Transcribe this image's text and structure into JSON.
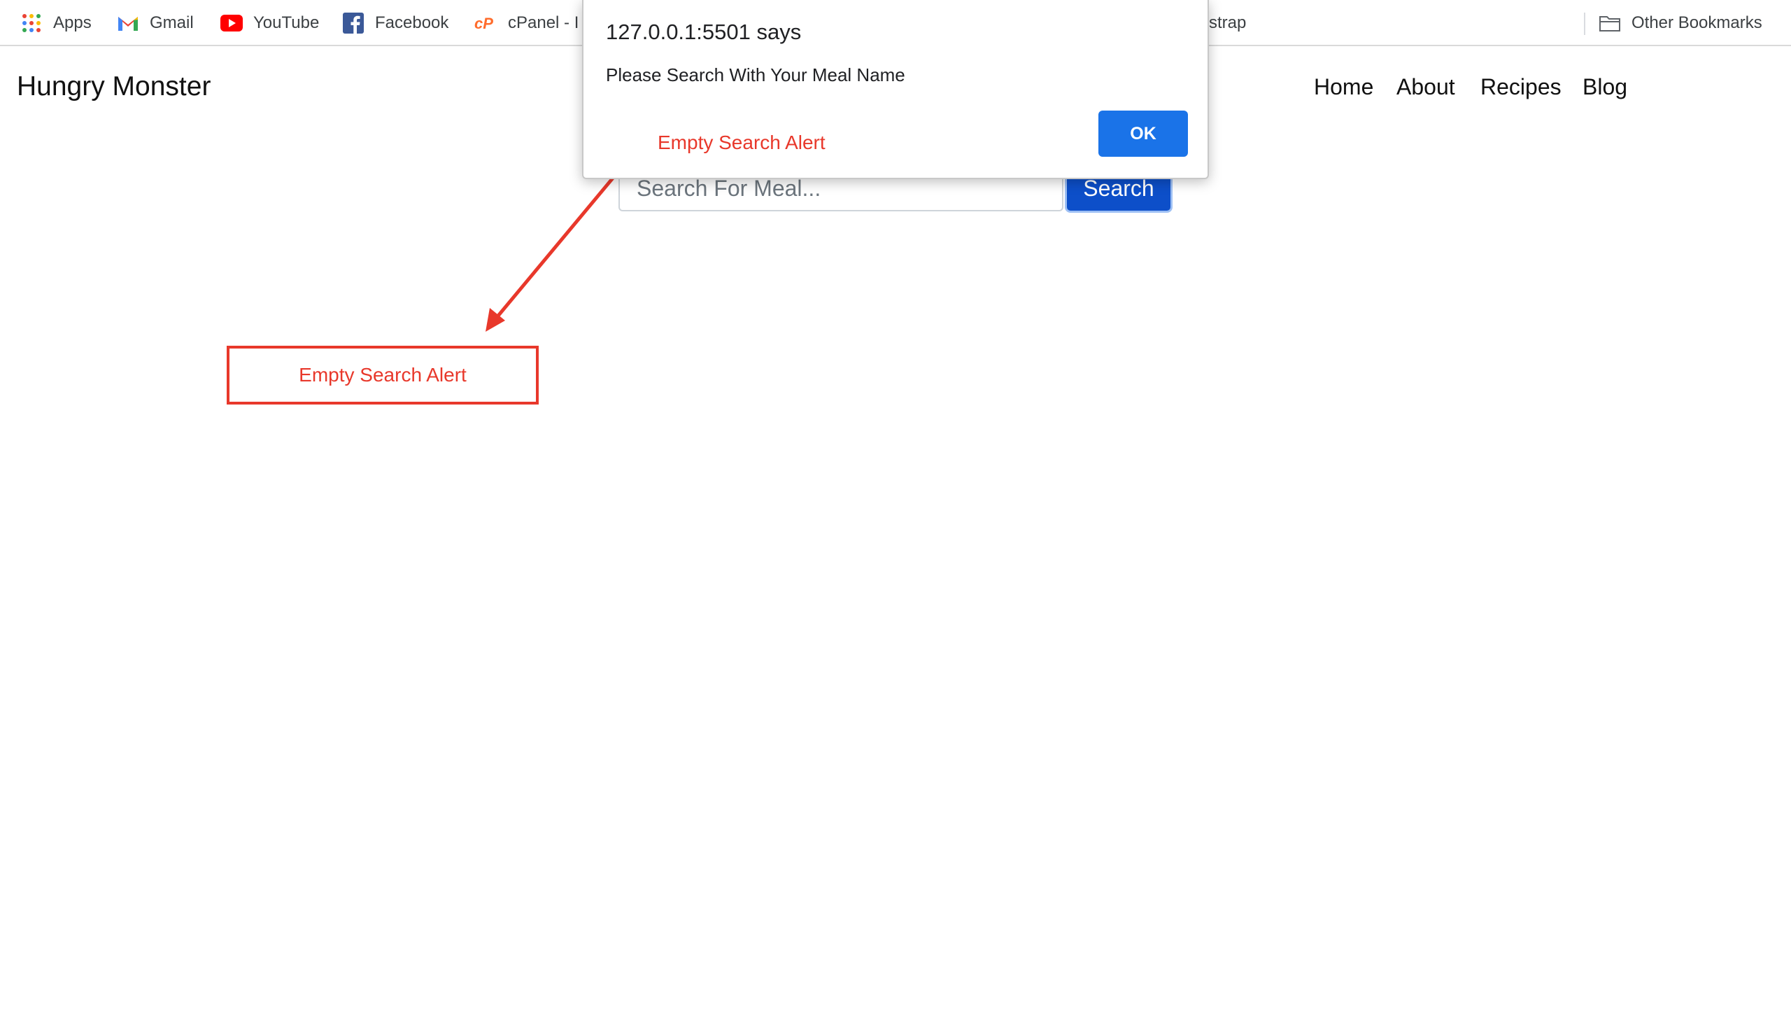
{
  "bookmarks": {
    "items": [
      {
        "label": "Apps",
        "icon": "apps-grid-icon"
      },
      {
        "label": "Gmail",
        "icon": "gmail-icon"
      },
      {
        "label": "YouTube",
        "icon": "youtube-icon"
      },
      {
        "label": "Facebook",
        "icon": "facebook-icon"
      },
      {
        "label": "cPanel - I",
        "icon": "cpanel-icon"
      },
      {
        "label": "strap",
        "icon": ""
      }
    ],
    "other": {
      "label": "Other Bookmarks",
      "icon": "folder-icon"
    }
  },
  "navbar": {
    "brand": "Hungry Monster",
    "links": [
      "Home",
      "About",
      "Recipes",
      "Blog"
    ]
  },
  "search": {
    "placeholder": "Search For Meal...",
    "button_label": "Search"
  },
  "dialog": {
    "title": "127.0.0.1:5501 says",
    "message": "Please Search With Your Meal Name",
    "ok_label": "OK"
  },
  "annotation": {
    "inline_label": "Empty Search Alert",
    "box_label": "Empty Search Alert",
    "color": "#e8382b"
  },
  "colors": {
    "primary_button": "#0d4fc9",
    "dialog_ok": "#1a73e8"
  }
}
